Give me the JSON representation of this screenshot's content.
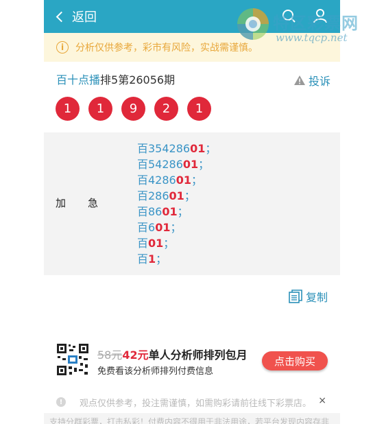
{
  "header": {
    "back_label": "返回",
    "bg_color": "#2aa6c4"
  },
  "watermark": {
    "name": "特区彩票网",
    "url": "www.tqcp.net"
  },
  "notice": {
    "text": "分析仅供参考，彩市有风险，实战需谨慎。"
  },
  "title": {
    "highlight": "百十点播",
    "rest": "排5第26056期"
  },
  "complain_label": "投诉",
  "balls": [
    "1",
    "1",
    "9",
    "2",
    "1"
  ],
  "row": {
    "label": "加急",
    "predictions": [
      {
        "prefix": "百354286",
        "last": "01",
        "sep": "；"
      },
      {
        "prefix": "百54286",
        "last": "01",
        "sep": "；"
      },
      {
        "prefix": "百4286",
        "last": "01",
        "sep": "；"
      },
      {
        "prefix": "百286",
        "last": "01",
        "sep": "；"
      },
      {
        "prefix": "百86",
        "last": "01",
        "sep": "；"
      },
      {
        "prefix": "百6",
        "last": "01",
        "sep": "；"
      },
      {
        "prefix": "百",
        "last": "01",
        "sep": "；"
      },
      {
        "prefix": "百",
        "last": "1",
        "sep": "；"
      }
    ]
  },
  "copy_label": "复制",
  "promo": {
    "old_price": "58元",
    "new_price": "42元",
    "name": "单人分析师排列包月",
    "subtitle": "免费看该分析师排列付费信息",
    "button": "点击购买"
  },
  "footer": {
    "text": "观点仅供参考，投注需谨慎，如需购彩请前往线下彩票店。",
    "close": "×",
    "bottom_text": "支持分群彩票，打击私彩！付费内容不得用于非法用途，若平台发现内容存非"
  }
}
